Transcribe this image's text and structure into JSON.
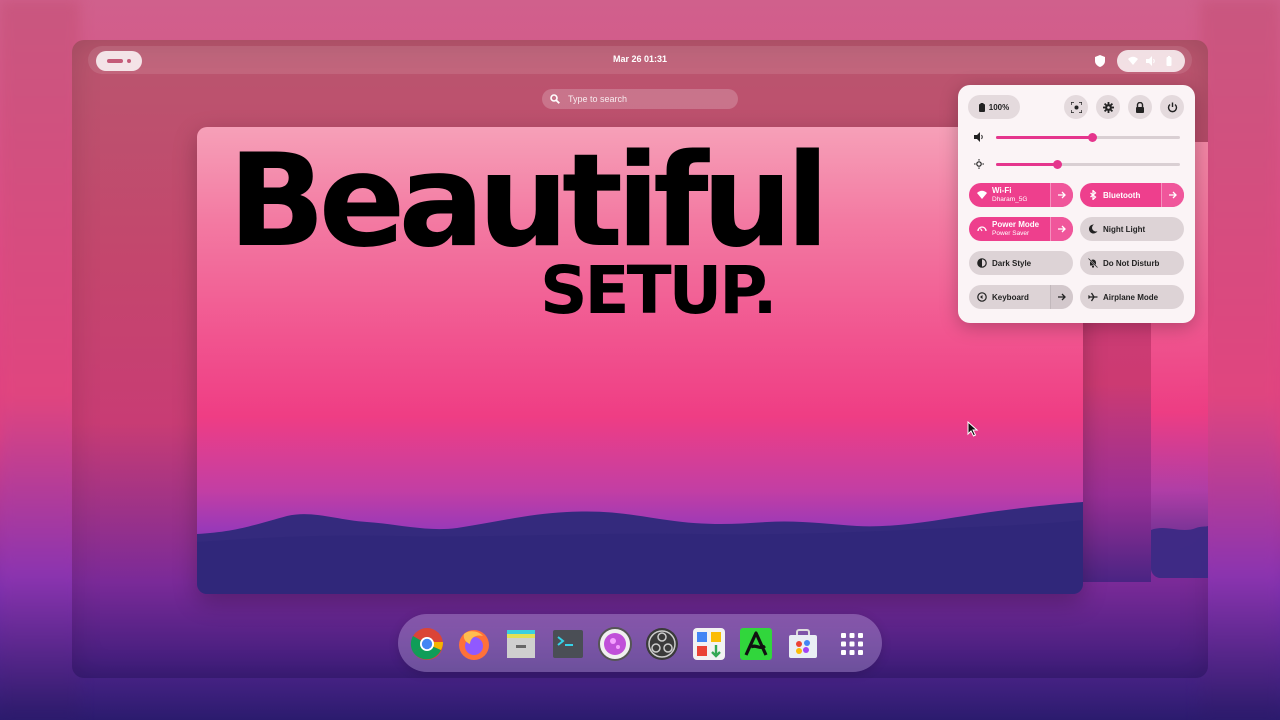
{
  "topbar": {
    "clock": "Mar 26  01:31"
  },
  "search": {
    "placeholder": "Type to search"
  },
  "wallpaper": {
    "headline": "Beautiful",
    "subline": "SETUP."
  },
  "quick_settings": {
    "battery_label": "100%",
    "volume_level": 0.52,
    "brightness_level": 0.33,
    "tiles": [
      {
        "label": "Wi-Fi",
        "sub": "Dharam_5G",
        "state": "on"
      },
      {
        "label": "Bluetooth",
        "sub": "",
        "state": "on"
      },
      {
        "label": "Power Mode",
        "sub": "Power Saver",
        "state": "on"
      },
      {
        "label": "Night Light",
        "sub": "",
        "state": "off"
      },
      {
        "label": "Dark Style",
        "sub": "",
        "state": "off"
      },
      {
        "label": "Do Not Disturb",
        "sub": "",
        "state": "off"
      },
      {
        "label": "Keyboard",
        "sub": "",
        "state": "off"
      },
      {
        "label": "Airplane Mode",
        "sub": "",
        "state": "off"
      }
    ]
  },
  "dock": {
    "apps": [
      "chrome-icon",
      "firefox-icon",
      "files-icon",
      "terminal-icon",
      "image-viewer-icon",
      "obs-icon",
      "software-icon",
      "a-app-icon",
      "store-icon",
      "app-grid-icon"
    ]
  },
  "colors": {
    "accent": "#ee3f8d",
    "panel": "#fbf4f6"
  }
}
